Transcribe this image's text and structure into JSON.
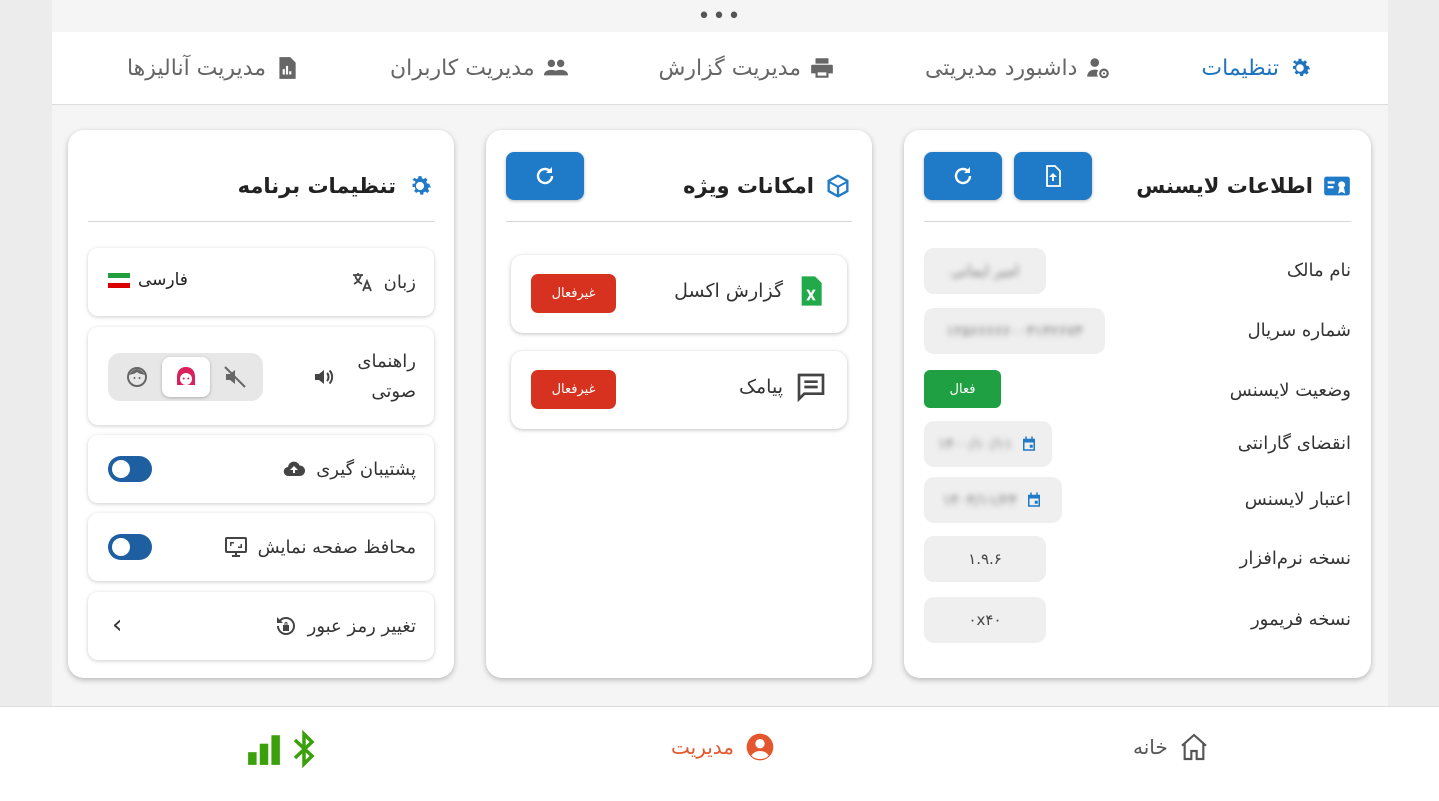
{
  "top_bar": {
    "menu_dots": "•••"
  },
  "tabs": [
    {
      "label": "تنظیمات",
      "icon": "gear-icon",
      "active": true
    },
    {
      "label": "داشبورد مدیریتی",
      "icon": "user-gear-icon",
      "active": false
    },
    {
      "label": "مدیریت گزارش",
      "icon": "printer-icon",
      "active": false
    },
    {
      "label": "مدیریت کاربران",
      "icon": "users-icon",
      "active": false
    },
    {
      "label": "مدیریت آنالیزها",
      "icon": "chart-file-icon",
      "active": false
    }
  ],
  "license": {
    "title": "اطلاعات لایسنس",
    "fields": {
      "owner": {
        "label": "نام مالک",
        "value": "امیر ایمانی"
      },
      "serial": {
        "label": "شماره سریال",
        "value": "۱۲۵۶۶۶۶۶۰۰۳۱۴۲۶۷۳"
      },
      "status": {
        "label": "وضعیت لایسنس",
        "value": "فعال"
      },
      "warranty": {
        "label": "انقضای گارانتی",
        "value": "۱۴۰۰/۱۰/۱۱"
      },
      "validity": {
        "label": "اعتبار لایسنس",
        "value": "۱۴۰۴/۱۱/۲۴"
      },
      "software": {
        "label": "نسخه نرم‌افزار",
        "value": "۱.۹.۶"
      },
      "firmware": {
        "label": "نسخه فریمور",
        "value": "۰x۴۰"
      }
    }
  },
  "features": {
    "title": "امکانات ویژه",
    "items": [
      {
        "label": "گزارش اکسل",
        "status": "غیرفعال",
        "icon": "excel-file-icon"
      },
      {
        "label": "پیامک",
        "status": "غیرفعال",
        "icon": "message-icon"
      }
    ]
  },
  "settings": {
    "title": "تنظیمات برنامه",
    "language": {
      "label": "زبان",
      "value": "فارسی",
      "flag": "🇮🇷"
    },
    "voice": {
      "label": "راهنمای صوتی"
    },
    "backup": {
      "label": "پشتیبان گیری"
    },
    "screensaver": {
      "label": "محافظ صفحه نمایش"
    },
    "password": {
      "label": "تغییر رمز عبور",
      "chevron": "‹"
    }
  },
  "bottom_nav": {
    "home": "خانه",
    "admin": "مدیریت"
  },
  "colors": {
    "primary": "#1f7ac8",
    "active_tab": "#1f74c0",
    "success": "#1ea043",
    "danger": "#d7321f",
    "nav_active": "#e4572e",
    "status_green": "#3aa10a"
  }
}
